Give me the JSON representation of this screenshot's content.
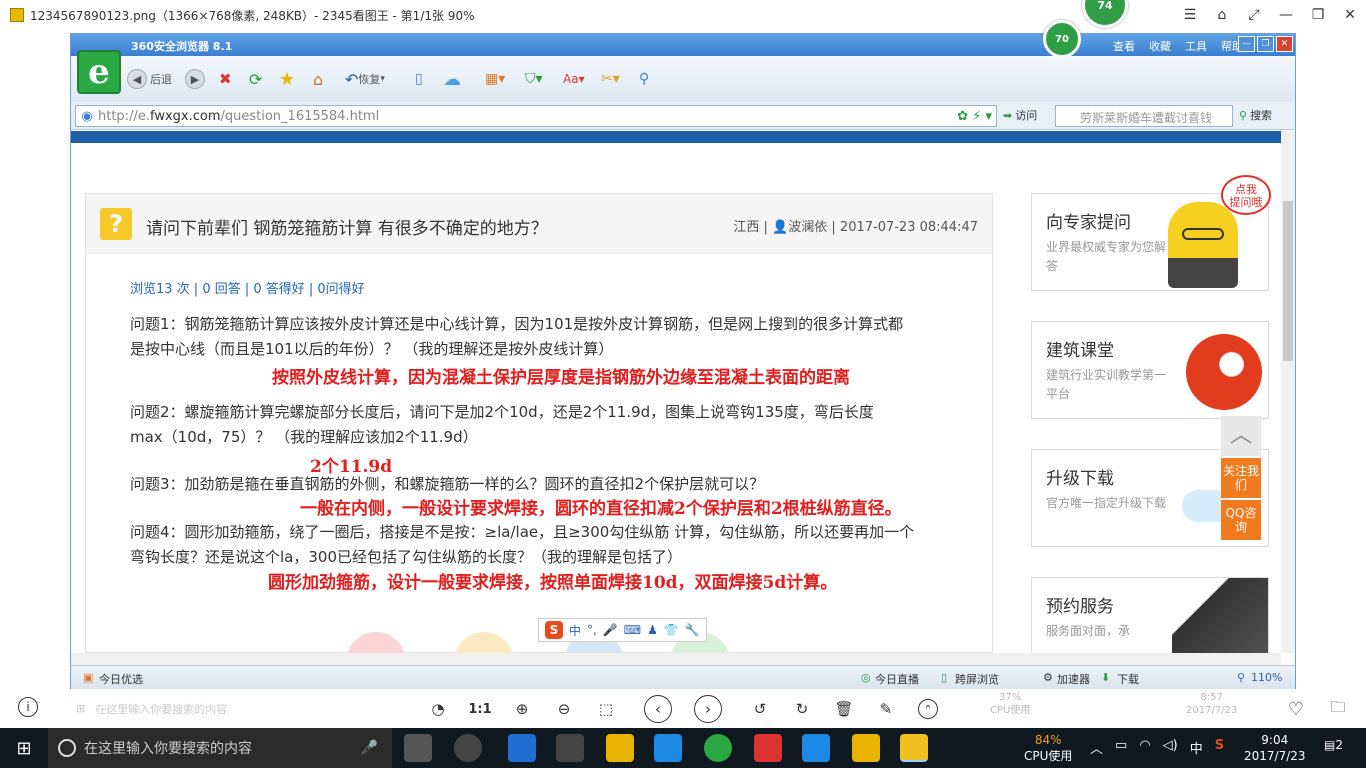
{
  "viewer": {
    "title": "1234567890123.png（1366×768像素, 248KB）- 2345看图王 - 第1/1张 90%",
    "badge": "74",
    "controls": [
      "☰",
      "⌂",
      "⤢",
      "—",
      "❐",
      "✕"
    ]
  },
  "browser": {
    "app_title": "360安全浏览器 8.1",
    "badge": "70",
    "menu": [
      "查看",
      "收藏",
      "工具",
      "帮助"
    ],
    "toolbar": {
      "back": "后退",
      "restore": "恢复"
    },
    "url_prefix": "http://e.",
    "url_domain": "fwxgx.com",
    "url_path": "/question_1615584.html",
    "visit_label": "访问",
    "search_placeholder": "劳斯莱斯婚车遭截讨喜钱",
    "search_label": "搜索",
    "status_left": "今日优选",
    "status_items": [
      "今日直播",
      "跨屏浏览",
      "加速器",
      "下载"
    ],
    "zoom": "110%",
    "sogou": "中"
  },
  "question": {
    "title": "请问下前辈们 钢筋笼箍筋计算 有很多不确定的地方？",
    "region": "江西",
    "user": "波澜依",
    "date": "2017-07-23 08:44:47",
    "stats": "浏览13 次 | 0 回答 | 0 答得好 | 0问得好",
    "q1_l1": "问题1：钢筋笼箍筋计算应该按外皮计算还是中心线计算，因为101是按外皮计算钢筋，但是网上搜到的很多计算式都",
    "q1_l2": "是按中心线（而且是101以后的年份）？ （我的理解还是按外皮线计算）",
    "a1": "按照外皮线计算，因为混凝土保护层厚度是指钢筋外边缘至混凝土表面的距离",
    "q2_l1": "问题2：螺旋箍筋计算完螺旋部分长度后，请问下是加2个10d，还是2个11.9d，图集上说弯钩135度，弯后长度",
    "q2_l2": "max（10d，75）？ （我的理解应该加2个11.9d）",
    "a2": "2个11.9d",
    "q3": "问题3：加劲筋是箍在垂直钢筋的外侧，和螺旋箍筋一样的么？圆环的直径扣2个保护层就可以？",
    "a3": "一般在内侧，一般设计要求焊接，圆环的直径扣减2个保护层和2根桩纵筋直径。",
    "q4_l1": "问题4：圆形加劲箍筋，绕了一圈后，搭接是不是按：≥la/lae，且≥300勾住纵筋 计算，勾住纵筋，所以还要再加一个",
    "q4_l2": "弯钩长度？还是说这个la，300已经包括了勾住纵筋的长度？（我的理解是包括了）",
    "a4": "圆形加劲箍筋，设计一般要求焊接，按照单面焊接10d，双面焊接5d计算。"
  },
  "sidebar": {
    "bubble": "点我\n提问哦",
    "cards": [
      {
        "title": "向专家提问",
        "sub": "业界最权威专家为您解答"
      },
      {
        "title": "建筑课堂",
        "sub": "建筑行业实训教学第一平台"
      },
      {
        "title": "升级下载",
        "sub": "官方唯一指定升级下载"
      },
      {
        "title": "预约服务",
        "sub": "服务面对面，承"
      }
    ],
    "follow": "关注我们",
    "qq": "QQ咨询"
  },
  "viewer_tools": {
    "ratio": "1:1",
    "cpu_small": "37%",
    "cpu_small_label": "CPU使用",
    "time_small": "8:57",
    "date_small": "2017/7/23",
    "search_small": "在这里输入你要搜索的内容"
  },
  "taskbar": {
    "search": "在这里输入你要搜索的内容",
    "cpu": "84%",
    "cpu_label": "CPU使用",
    "ime": "中",
    "time": "9:04",
    "date": "2017/7/23",
    "notif": "2"
  }
}
